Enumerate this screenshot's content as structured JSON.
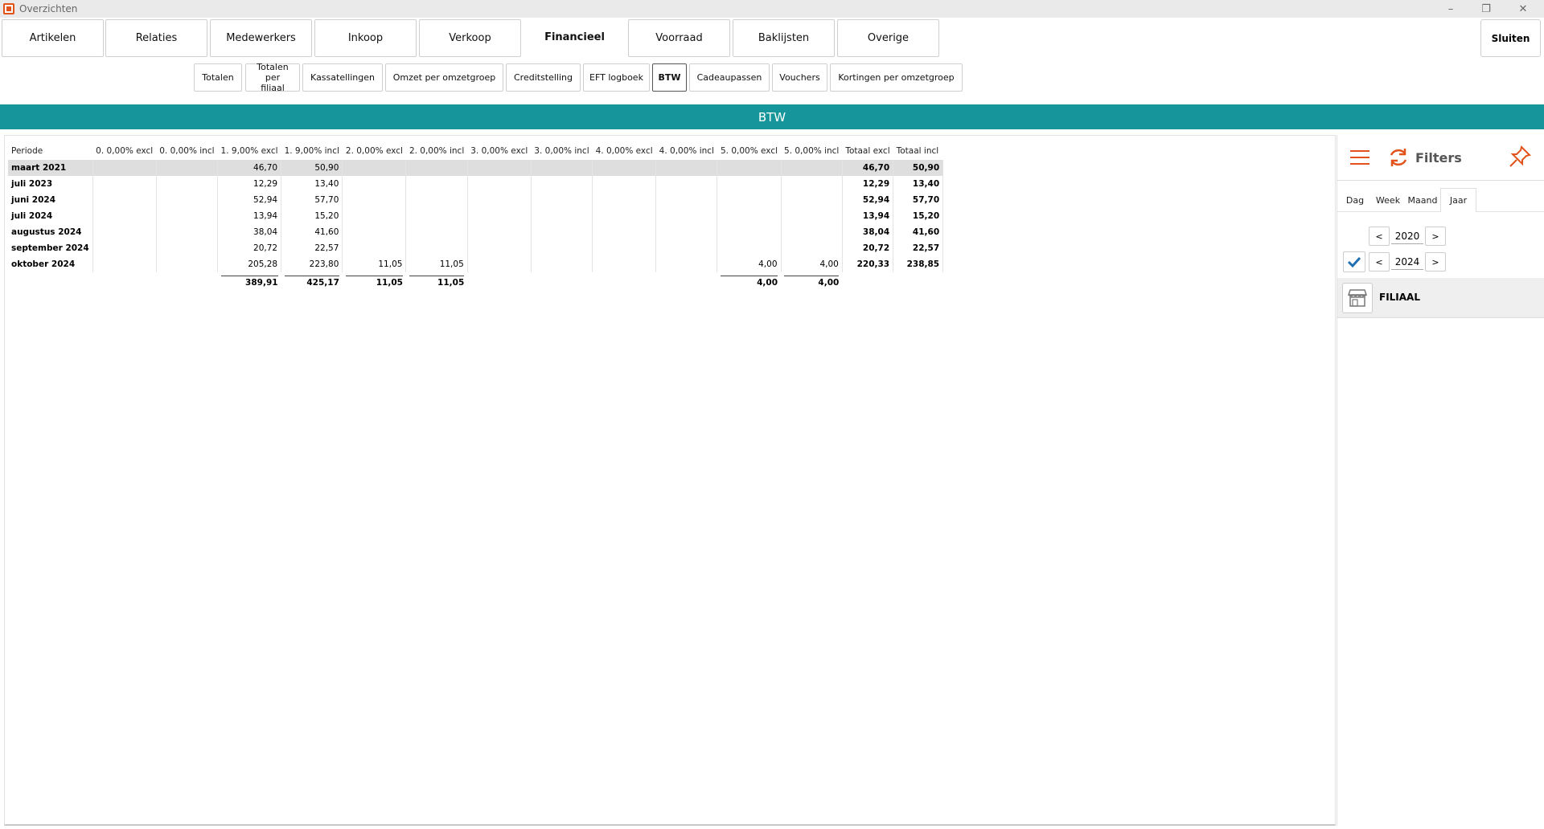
{
  "window": {
    "title": "Overzichten"
  },
  "main_tabs": [
    {
      "label": "Artikelen"
    },
    {
      "label": "Relaties"
    },
    {
      "label": "Medewerkers"
    },
    {
      "label": "Inkoop"
    },
    {
      "label": "Verkoop"
    },
    {
      "label": "Financieel"
    },
    {
      "label": "Voorraad"
    },
    {
      "label": "Baklijsten"
    },
    {
      "label": "Overige"
    }
  ],
  "close_label": "Sluiten",
  "sub_tabs": [
    {
      "label": "Totalen"
    },
    {
      "label": "Totalen per filiaal"
    },
    {
      "label": "Kassatellingen"
    },
    {
      "label": "Omzet per omzetgroep"
    },
    {
      "label": "Creditstelling"
    },
    {
      "label": "EFT logboek"
    },
    {
      "label": "BTW"
    },
    {
      "label": "Cadeaupassen"
    },
    {
      "label": "Vouchers"
    },
    {
      "label": "Kortingen per omzetgroep"
    }
  ],
  "banner": "BTW",
  "table": {
    "headers": [
      "Periode",
      "0. 0,00% excl",
      "0. 0,00% incl",
      "1. 9,00% excl",
      "1. 9,00% incl",
      "2. 0,00% excl",
      "2. 0,00% incl",
      "3. 0,00% excl",
      "3. 0,00% incl",
      "4. 0,00% excl",
      "4. 0,00% incl",
      "5. 0,00% excl",
      "5. 0,00% incl",
      "Totaal excl",
      "Totaal incl"
    ],
    "rows": [
      [
        "maart 2021",
        "",
        "",
        "46,70",
        "50,90",
        "",
        "",
        "",
        "",
        "",
        "",
        "",
        "",
        "46,70",
        "50,90"
      ],
      [
        "juli 2023",
        "",
        "",
        "12,29",
        "13,40",
        "",
        "",
        "",
        "",
        "",
        "",
        "",
        "",
        "12,29",
        "13,40"
      ],
      [
        "juni 2024",
        "",
        "",
        "52,94",
        "57,70",
        "",
        "",
        "",
        "",
        "",
        "",
        "",
        "",
        "52,94",
        "57,70"
      ],
      [
        "juli 2024",
        "",
        "",
        "13,94",
        "15,20",
        "",
        "",
        "",
        "",
        "",
        "",
        "",
        "",
        "13,94",
        "15,20"
      ],
      [
        "augustus 2024",
        "",
        "",
        "38,04",
        "41,60",
        "",
        "",
        "",
        "",
        "",
        "",
        "",
        "",
        "38,04",
        "41,60"
      ],
      [
        "september 2024",
        "",
        "",
        "20,72",
        "22,57",
        "",
        "",
        "",
        "",
        "",
        "",
        "",
        "",
        "20,72",
        "22,57"
      ],
      [
        "oktober 2024",
        "",
        "",
        "205,28",
        "223,80",
        "11,05",
        "11,05",
        "",
        "",
        "",
        "",
        "4,00",
        "4,00",
        "220,33",
        "238,85"
      ]
    ],
    "totals": [
      "",
      "",
      "",
      "389,91",
      "425,17",
      "11,05",
      "11,05",
      "",
      "",
      "",
      "",
      "4,00",
      "4,00",
      "",
      ""
    ]
  },
  "filters": {
    "title": "Filters",
    "period_tabs": [
      {
        "label": "Dag"
      },
      {
        "label": "Week"
      },
      {
        "label": "Maand"
      },
      {
        "label": "Jaar"
      }
    ],
    "active_period": "Jaar",
    "from_year": "2020",
    "to_year": "2024",
    "prev": "<",
    "next": ">",
    "filiaal_label": "FILIAAL"
  },
  "colors": {
    "accent": "#e2531b",
    "banner": "#16969b"
  }
}
